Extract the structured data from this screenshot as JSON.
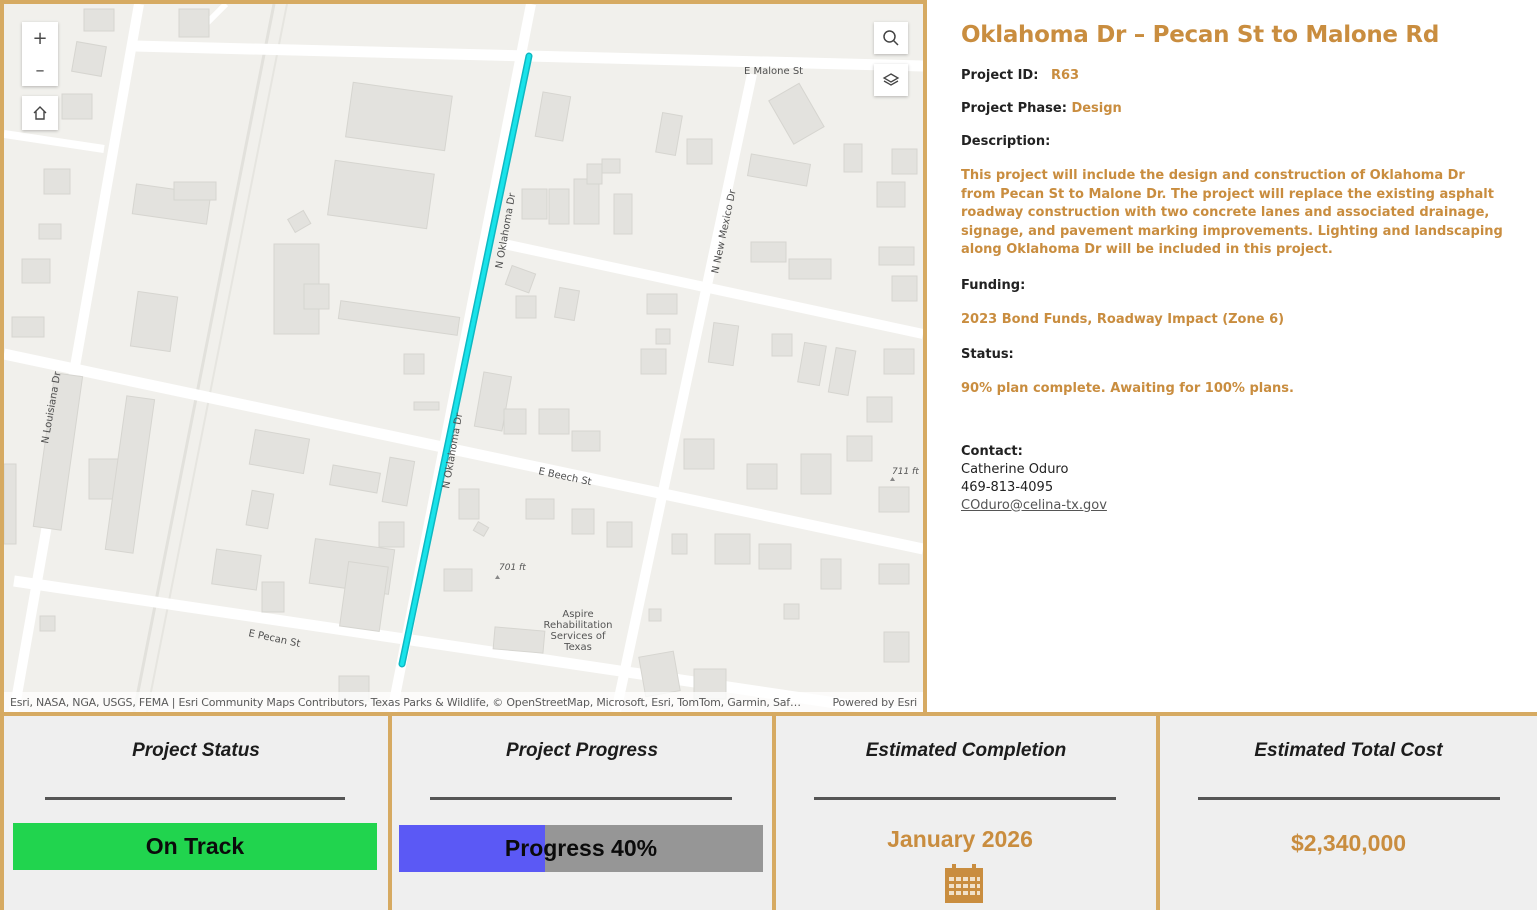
{
  "map": {
    "streets": {
      "e_malone": "E Malone St",
      "n_oklahoma_top": "N Oklahoma Dr",
      "n_oklahoma_bottom": "N Oklahoma Dr",
      "n_new_mexico": "N New Mexico Dr",
      "n_louisiana": "N Louisiana Dr",
      "e_beech": "E Beech St",
      "e_pecan": "E Pecan St"
    },
    "elevations": {
      "e1": "711 ft",
      "e2": "701 ft"
    },
    "poi": {
      "line1": "Aspire",
      "line2": "Rehabilitation",
      "line3": "Services of",
      "line4": "Texas"
    },
    "controls": {
      "zoom_in": "+",
      "zoom_out": "–"
    },
    "attribution": "Esri, NASA, NGA, USGS, FEMA | Esri Community Maps Contributors, Texas Parks & Wildlife, © OpenStreetMap, Microsoft, Esri, TomTom, Garmin, Saf…",
    "powered_by": "Powered by Esri",
    "colors": {
      "project_line": "#19e3ea",
      "background": "#f1f0ec"
    },
    "icons": [
      "zoom-in-icon",
      "zoom-out-icon",
      "home-icon",
      "search-icon",
      "layers-icon"
    ]
  },
  "details": {
    "title": "Oklahoma Dr – Pecan St to Malone Rd",
    "project_id_label": "Project ID:",
    "project_id_value": "R63",
    "phase_label": "Project Phase:",
    "phase_value": "Design",
    "description_label": "Description:",
    "description_text": "This project will include the design and construction of Oklahoma Dr from Pecan St to Malone Dr. The project will replace the existing asphalt roadway construction with two concrete lanes and associated drainage, signage, and pavement marking improvements. Lighting and landscaping along Oklahoma Dr will be included in this project.",
    "funding_label": "Funding:",
    "funding_text": "2023 Bond Funds, Roadway Impact (Zone 6)",
    "status_label": "Status:",
    "status_text": "90% plan complete. Awaiting for 100% plans.",
    "contact_label": "Contact:",
    "contact_name": "Catherine Oduro",
    "contact_phone": "469-813-4095",
    "contact_email": "COduro@celina-tx.gov"
  },
  "cards": {
    "status": {
      "title": "Project Status",
      "value": "On Track",
      "color": "#21d44e"
    },
    "progress": {
      "title": "Project Progress",
      "label": "Progress 40%",
      "percent": 40,
      "fill_color": "#5b59f5",
      "track_color": "#969696"
    },
    "completion": {
      "title": "Estimated Completion",
      "value": "January 2026",
      "icon": "calendar-icon"
    },
    "cost": {
      "title": "Estimated Total Cost",
      "value": "$2,340,000"
    }
  },
  "theme": {
    "accent": "#c98d3f",
    "border": "#d6aa62"
  }
}
